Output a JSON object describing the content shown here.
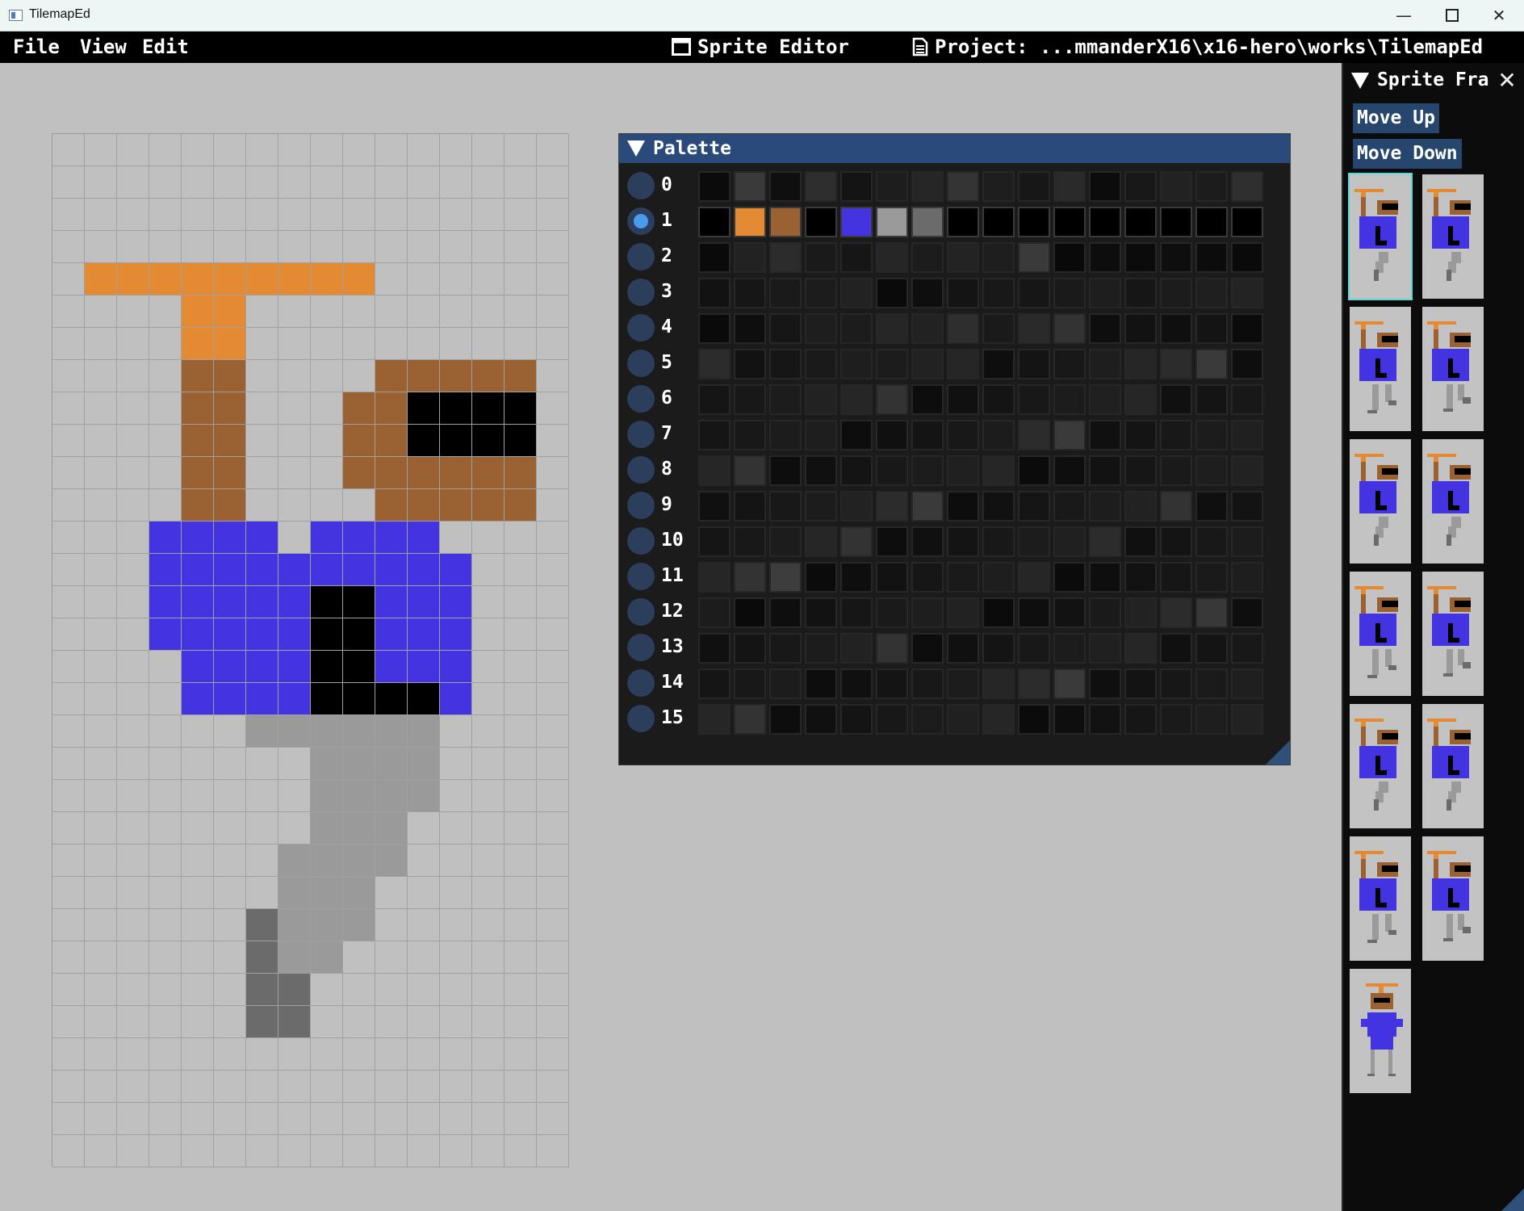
{
  "window": {
    "title": "TilemapEd"
  },
  "menubar": {
    "menus": [
      "File",
      "View",
      "Edit"
    ],
    "mode_label": "Sprite Editor",
    "project_label": "Project: ...mmanderX16\\x16-hero\\works\\TilemapEd"
  },
  "colors": {
    "0": "#c0c0c0",
    "1": "#e48a33",
    "2": "#9a6232",
    "3": "#000000",
    "4": "#4433e0",
    "5": "#9a9a9a",
    "6": "#6b6b6b"
  },
  "sprite_canvas": {
    "columns": 16,
    "rows": 32,
    "pixels": [
      "0000000000000000",
      "0000000000000000",
      "0000000000000000",
      "0000000000000000",
      "0111111111000000",
      "0000110000000000",
      "0000110000000000",
      "0000220000222220",
      "0000220002233330",
      "0000220002233330",
      "0000220002222220",
      "0000220000222220",
      "0004444044440000",
      "0004444444444000",
      "0004444433444000",
      "0004444433444000",
      "0000444433444000",
      "0000444433334000",
      "0000005555550000",
      "0000000055550000",
      "0000000055550000",
      "0000000055500000",
      "0000000555500000",
      "0000000555000000",
      "0000006555000000",
      "0000006550000000",
      "0000006600000000",
      "0000006600000000",
      "0000000000000000",
      "0000000000000000",
      "0000000000000000",
      "0000000000000000"
    ]
  },
  "palette": {
    "title": "Palette",
    "selected_row": 1,
    "rows": [
      {
        "label": "0",
        "colors": [
          "#0b0b0b",
          "#3a3a3a",
          "#0f0f0f",
          "#2e2e2e",
          "#141414",
          "#1d1d1d",
          "#262626",
          "#343434",
          "#1e1e1e",
          "#171717",
          "#2a2a2a",
          "#0c0c0c",
          "#181818",
          "#222222",
          "#1c1c1c",
          "#2f2f2f"
        ]
      },
      {
        "label": "1",
        "colors": [
          "#000000",
          "#e48a33",
          "#9a6232",
          "#000000",
          "#4433e0",
          "#9a9a9a",
          "#6b6b6b",
          "#000000",
          "#000000",
          "#000000",
          "#000000",
          "#000000",
          "#000000",
          "#000000",
          "#000000",
          "#000000"
        ]
      },
      {
        "label": "2",
        "colors": [
          "#0a0a0a",
          "#222222",
          "#2c2c2c",
          "#1a1a1a",
          "#161616",
          "#262626",
          "#1c1c1c",
          "#232323",
          "#1e1e1e",
          "#3a3a3a",
          "#090909",
          "#0d0d0d",
          "#0b0b0b",
          "#0e0e0e",
          "#0c0c0c",
          "#0a0a0a"
        ]
      },
      {
        "label": "3",
        "colors": [
          "#121212",
          "#161616",
          "#1a1a1a",
          "#1c1c1c",
          "#222222",
          "#0a0a0a",
          "#0e0e0e",
          "#141414",
          "#181818",
          "#161616",
          "#1a1a1a",
          "#1e1e1e",
          "#161616",
          "#1c1c1c",
          "#1f1f1f",
          "#232323"
        ]
      },
      {
        "label": "4",
        "colors": [
          "#0a0a0a",
          "#0e0e0e",
          "#161616",
          "#1e1e1e",
          "#1c1c1c",
          "#262626",
          "#222222",
          "#2e2e2e",
          "#1a1a1a",
          "#2a2a2a",
          "#333333",
          "#0e0e0e",
          "#121212",
          "#0f0f0f",
          "#141414",
          "#0b0b0b"
        ]
      },
      {
        "label": "5",
        "colors": [
          "#2c2c2c",
          "#121212",
          "#161616",
          "#1a1a1a",
          "#1e1e1e",
          "#1c1c1c",
          "#222222",
          "#262626",
          "#0e0e0e",
          "#141414",
          "#181818",
          "#1e1e1e",
          "#262626",
          "#2c2c2c",
          "#3a3a3a",
          "#0e0e0e"
        ]
      },
      {
        "label": "6",
        "colors": [
          "#151515",
          "#181818",
          "#1c1c1c",
          "#222222",
          "#262626",
          "#333333",
          "#0d0d0d",
          "#101010",
          "#141414",
          "#181818",
          "#1c1c1c",
          "#202020",
          "#262626",
          "#101010",
          "#141414",
          "#181818"
        ]
      },
      {
        "label": "7",
        "colors": [
          "#151515",
          "#181818",
          "#1c1c1c",
          "#1e1e1e",
          "#0d0d0d",
          "#101010",
          "#141414",
          "#181818",
          "#1c1c1c",
          "#2c2c2c",
          "#3a3a3a",
          "#101010",
          "#141414",
          "#181818",
          "#1c1c1c",
          "#202020"
        ]
      },
      {
        "label": "8",
        "colors": [
          "#262626",
          "#333333",
          "#0d0d0d",
          "#101010",
          "#141414",
          "#181818",
          "#1c1c1c",
          "#202020",
          "#262626",
          "#0b0b0b",
          "#0e0e0e",
          "#121212",
          "#161616",
          "#1a1a1a",
          "#1e1e1e",
          "#222222"
        ]
      },
      {
        "label": "9",
        "colors": [
          "#101010",
          "#141414",
          "#181818",
          "#1c1c1c",
          "#222222",
          "#2c2c2c",
          "#3a3a3a",
          "#0d0d0d",
          "#111111",
          "#151515",
          "#191919",
          "#1d1d1d",
          "#222222",
          "#333333",
          "#0f0f0f",
          "#131313"
        ]
      },
      {
        "label": "10",
        "colors": [
          "#151515",
          "#181818",
          "#1c1c1c",
          "#262626",
          "#333333",
          "#0d0d0d",
          "#101010",
          "#141414",
          "#181818",
          "#1c1c1c",
          "#202020",
          "#2c2c2c",
          "#101010",
          "#141414",
          "#181818",
          "#1c1c1c"
        ]
      },
      {
        "label": "11",
        "colors": [
          "#262626",
          "#333333",
          "#3d3d3d",
          "#0b0b0b",
          "#0e0e0e",
          "#121212",
          "#161616",
          "#1a1a1a",
          "#1e1e1e",
          "#262626",
          "#0b0b0b",
          "#0e0e0e",
          "#121212",
          "#161616",
          "#1a1a1a",
          "#1e1e1e"
        ]
      },
      {
        "label": "12",
        "colors": [
          "#1c1c1c",
          "#0a0a0a",
          "#0e0e0e",
          "#121212",
          "#161616",
          "#1a1a1a",
          "#1e1e1e",
          "#222222",
          "#0b0b0b",
          "#0e0e0e",
          "#121212",
          "#1a1a1a",
          "#222222",
          "#2c2c2c",
          "#383838",
          "#0e0e0e"
        ]
      },
      {
        "label": "13",
        "colors": [
          "#101010",
          "#141414",
          "#181818",
          "#1c1c1c",
          "#222222",
          "#333333",
          "#0d0d0d",
          "#101010",
          "#141414",
          "#181818",
          "#1c1c1c",
          "#202020",
          "#262626",
          "#101010",
          "#141414",
          "#181818"
        ]
      },
      {
        "label": "14",
        "colors": [
          "#151515",
          "#181818",
          "#1c1c1c",
          "#0d0d0d",
          "#101010",
          "#141414",
          "#181818",
          "#1c1c1c",
          "#262626",
          "#2c2c2c",
          "#3a3a3a",
          "#0f0f0f",
          "#131313",
          "#171717",
          "#1b1b1b",
          "#1f1f1f"
        ]
      },
      {
        "label": "15",
        "colors": [
          "#262626",
          "#333333",
          "#0d0d0d",
          "#101010",
          "#141414",
          "#181818",
          "#1c1c1c",
          "#202020",
          "#262626",
          "#0b0b0b",
          "#0e0e0e",
          "#121212",
          "#161616",
          "#1a1a1a",
          "#1e1e1e",
          "#222222"
        ]
      }
    ]
  },
  "frames_panel": {
    "title": "Sprite Frames",
    "buttons": {
      "move_up": "Move Up",
      "move_down": "Move Down"
    },
    "frame_count": 13,
    "selected_frame": 0
  }
}
